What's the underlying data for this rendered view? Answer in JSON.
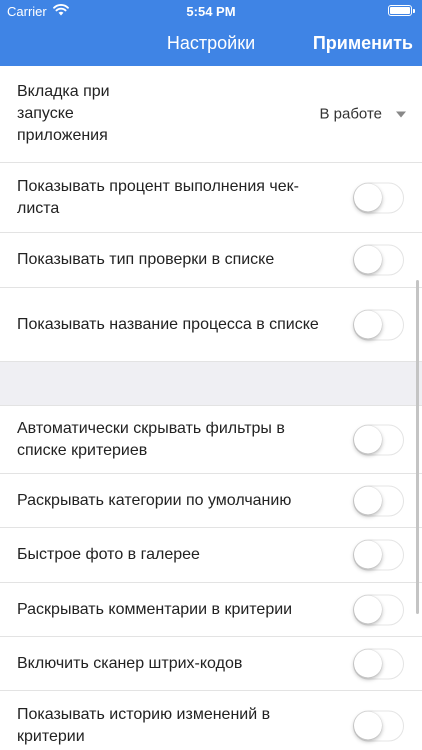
{
  "status_bar": {
    "carrier": "Carrier",
    "time": "5:54 PM"
  },
  "nav": {
    "title": "Настройки",
    "apply_label": "Применить"
  },
  "colors": {
    "header": "#3f84e5",
    "toggle_off": "#ffffff",
    "section_gap": "#efeff3"
  },
  "launch_tab": {
    "label": "Вкладка при запуске приложения",
    "value": "В работе"
  },
  "settings_group_1": [
    {
      "label": "Показывать процент выполнения чек-листа",
      "enabled": false
    },
    {
      "label": "Показывать тип проверки в списке",
      "enabled": false
    },
    {
      "label": "Показывать название процесса в списке",
      "enabled": false
    }
  ],
  "settings_group_2": [
    {
      "label": "Автоматически скрывать фильтры в списке критериев",
      "enabled": false
    },
    {
      "label": "Раскрывать категории по умолчанию",
      "enabled": false
    },
    {
      "label": "Быстрое фото в галерее",
      "enabled": false
    },
    {
      "label": "Раскрывать комментарии в критерии",
      "enabled": false
    },
    {
      "label": "Включить сканер штрих-кодов",
      "enabled": false
    },
    {
      "label": "Показывать историю изменений в критерии",
      "enabled": false
    }
  ]
}
